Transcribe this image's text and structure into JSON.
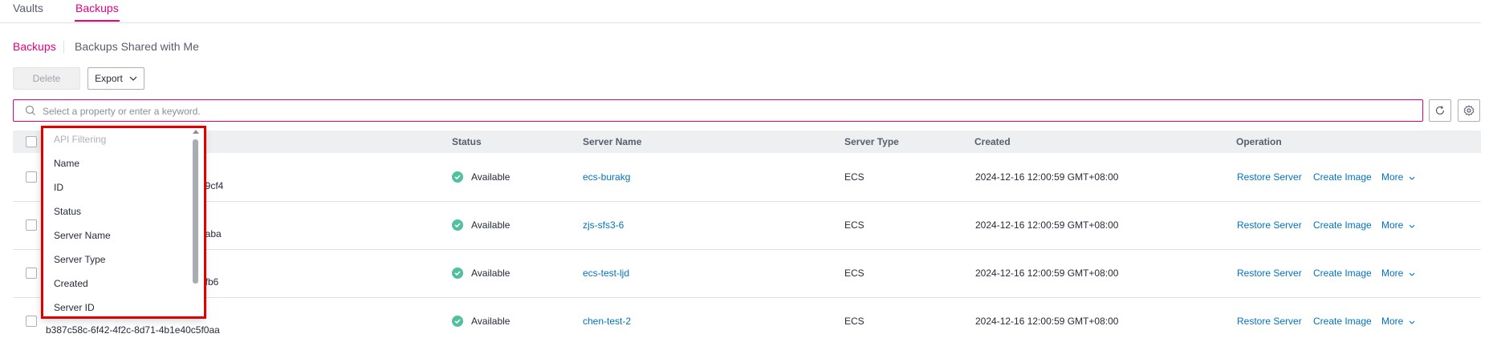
{
  "tabs": [
    {
      "label": "Vaults",
      "active": false
    },
    {
      "label": "Backups",
      "active": true
    }
  ],
  "subnav": {
    "active": "Backups",
    "other": "Backups Shared with Me"
  },
  "toolbar": {
    "delete_label": "Delete",
    "export_label": "Export"
  },
  "search": {
    "placeholder": "Select a property or enter a keyword."
  },
  "table": {
    "columns": [
      "Status",
      "Server Name",
      "Server Type",
      "Created",
      "Operation"
    ],
    "rows": [
      {
        "id_tail": "e9cf4",
        "status": "Available",
        "server_name": "ecs-burakg",
        "server_type": "ECS",
        "created": "2024-12-16 12:00:59 GMT+08:00",
        "op1": "Restore Server",
        "op2": "Create Image",
        "op3": "More"
      },
      {
        "id_tail": "8aba",
        "status": "Available",
        "server_name": "zjs-sfs3-6",
        "server_type": "ECS",
        "created": "2024-12-16 12:00:59 GMT+08:00",
        "op1": "Restore Server",
        "op2": "Create Image",
        "op3": "More"
      },
      {
        "id_tail": "afb6",
        "status": "Available",
        "server_name": "ecs-test-ljd",
        "server_type": "ECS",
        "created": "2024-12-16 12:00:59 GMT+08:00",
        "op1": "Restore Server",
        "op2": "Create Image",
        "op3": "More"
      },
      {
        "id_tail": "b387c58c-6f42-4f2c-8d71-4b1e40c5f0aa",
        "status": "Available",
        "server_name": "chen-test-2",
        "server_type": "ECS",
        "created": "2024-12-16 12:00:59 GMT+08:00",
        "op1": "Restore Server",
        "op2": "Create Image",
        "op3": "More"
      }
    ]
  },
  "dropdown": {
    "header": "API Filtering",
    "items": [
      "Name",
      "ID",
      "Status",
      "Server Name",
      "Server Type",
      "Created",
      "Server ID"
    ]
  },
  "colors": {
    "accent": "#e5007f",
    "link": "#0073bd",
    "status_ok": "#50c09e",
    "highlight": "#e00000"
  }
}
